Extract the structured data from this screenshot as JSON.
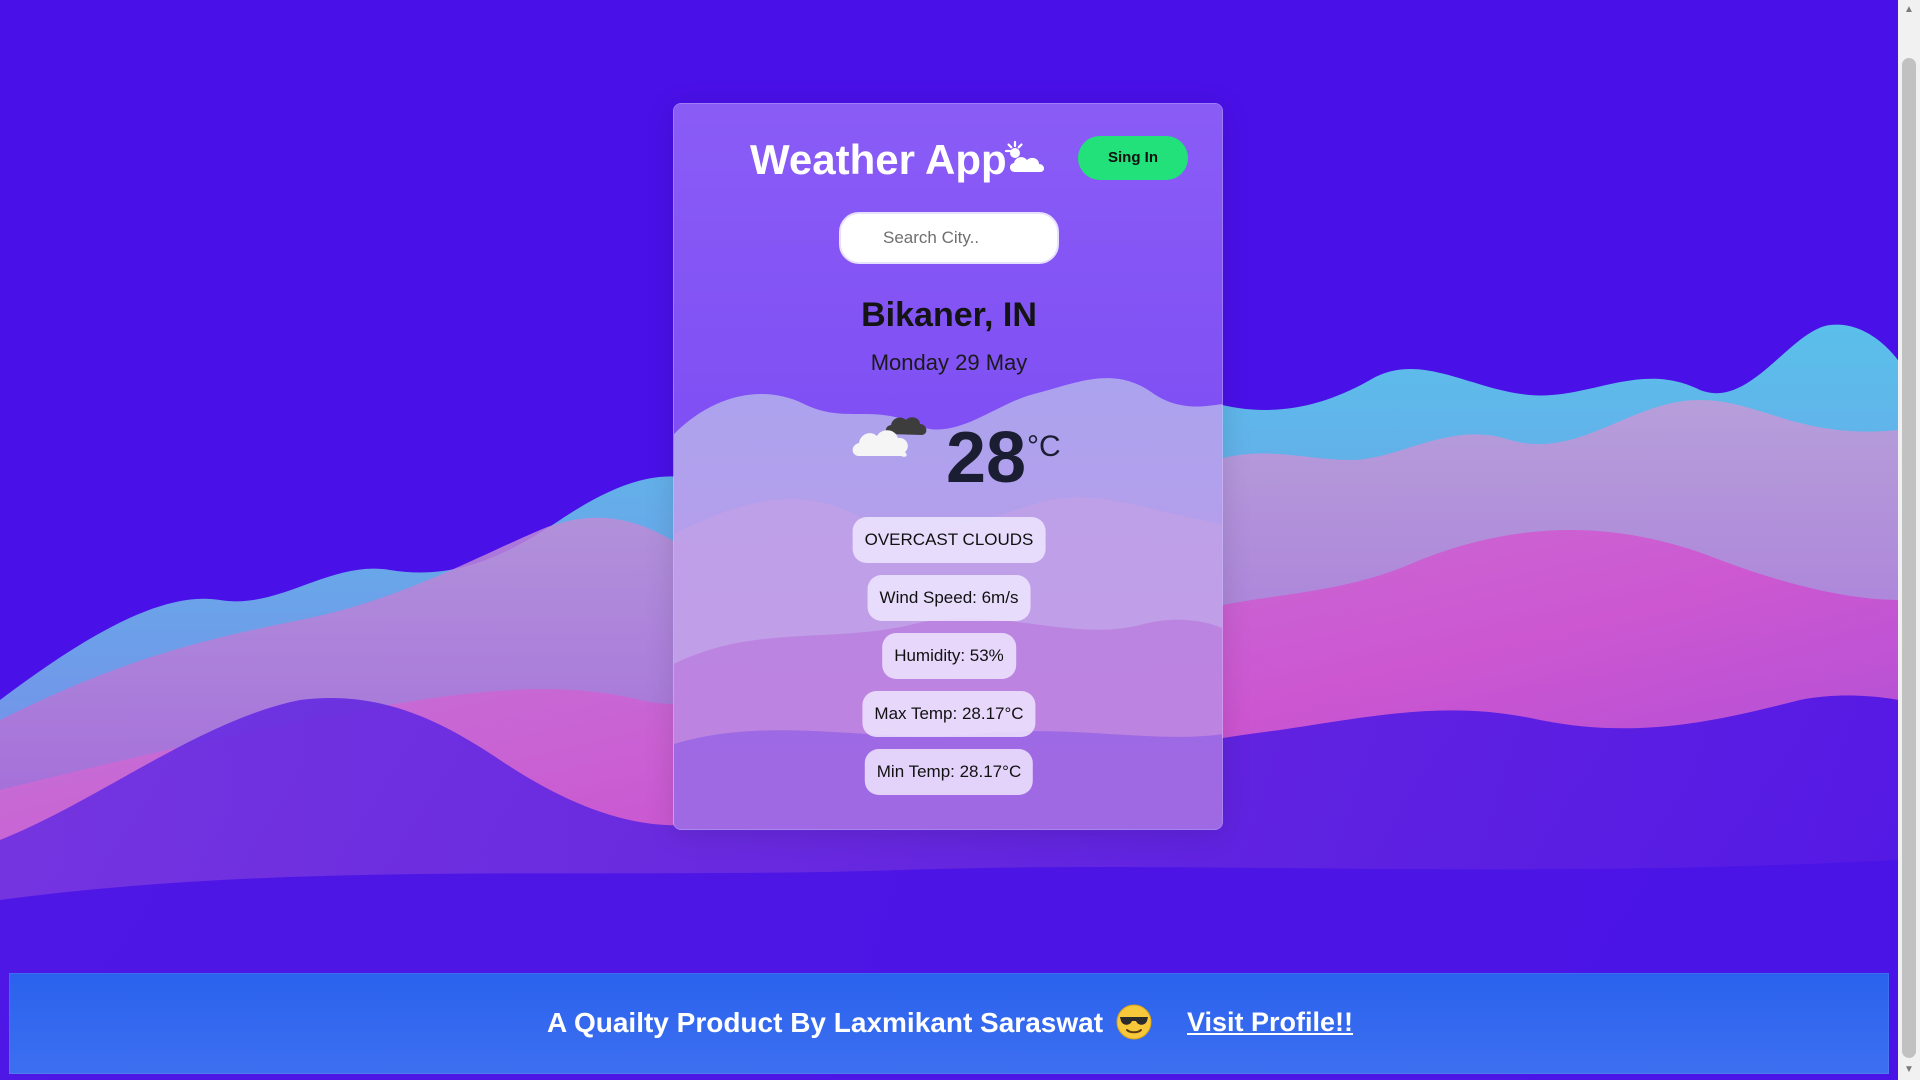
{
  "header": {
    "title": "Weather App",
    "title_icon": "sun-cloud-icon",
    "signin_label": "Sing In"
  },
  "search": {
    "placeholder": "Search City..",
    "value": ""
  },
  "weather": {
    "location": "Bikaner, IN",
    "date": "Monday 29 May",
    "icon": "overcast-clouds-icon",
    "temperature": "28",
    "unit": "°C",
    "description": "OVERCAST CLOUDS",
    "wind": "Wind Speed: 6m/s",
    "humidity": "Humidity: 53%",
    "max_temp": "Max Temp: 28.17°C",
    "min_temp": "Min Temp: 28.17°C"
  },
  "footer": {
    "text": "A Quailty Product By Laxmikant Saraswat",
    "emoji": "sunglasses-face-icon",
    "link_label": "Visit Profile!!"
  },
  "colors": {
    "background": "#4a10e8",
    "signin_button": "#22e07a",
    "footer": "#2a62ee",
    "card": "#966eff"
  }
}
